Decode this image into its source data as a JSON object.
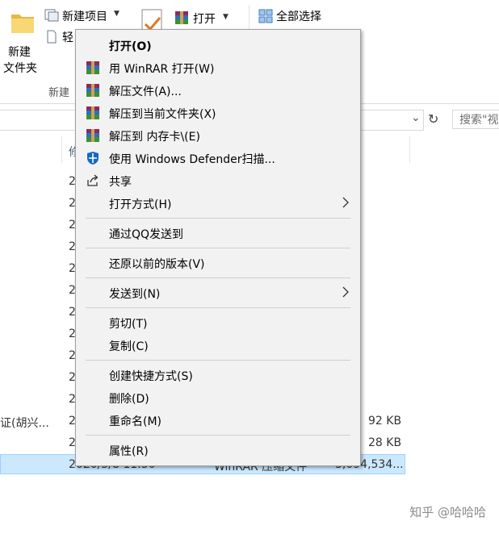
{
  "ribbon": {
    "new_folder_line1": "新建",
    "new_folder_line2": "文件夹",
    "new_item": "新建项目",
    "easy_access": "轻",
    "open": "打开",
    "select_all": "全部选择",
    "group_new": "新建"
  },
  "search": {
    "placeholder": "搜索\"视"
  },
  "columns": {
    "modified_partial": "修"
  },
  "rows": {
    "date_prefix": "2",
    "name_partial": "证(胡兴...",
    "size_1": "92 KB",
    "size_2": "28 KB",
    "selected_date": "2020/5/8 11:50",
    "selected_type": "WinRAR 压缩文件",
    "selected_size": "3,094,534..."
  },
  "menu": {
    "open": "打开(O)",
    "winrar_open": "用 WinRAR 打开(W)",
    "extract_files": "解压文件(A)...",
    "extract_here": "解压到当前文件夹(X)",
    "extract_to": "解压到 内存卡\\(E)",
    "defender": "使用 Windows Defender扫描...",
    "share": "共享",
    "open_with": "打开方式(H)",
    "send_qq": "通过QQ发送到",
    "restore": "还原以前的版本(V)",
    "send_to": "发送到(N)",
    "cut": "剪切(T)",
    "copy": "复制(C)",
    "create_shortcut": "创建快捷方式(S)",
    "delete": "删除(D)",
    "rename": "重命名(M)",
    "properties": "属性(R)"
  },
  "watermark": "知乎 @哈哈哈",
  "colors": {
    "selection": "#cce8ff",
    "menu_bg": "#f2f2f2",
    "defender_blue": "#1468c4"
  }
}
